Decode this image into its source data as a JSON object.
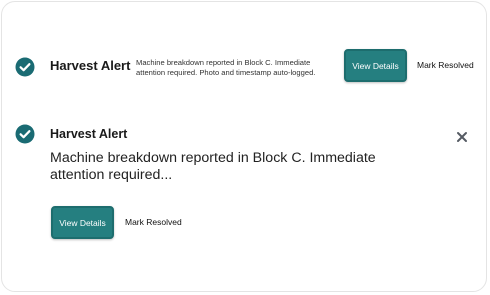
{
  "colors": {
    "accent": "#257f80",
    "check_fill": "#1a6b73",
    "close_icon": "#555b63"
  },
  "icons": {
    "status": "check-circle-icon",
    "dismiss": "close-icon"
  },
  "alert_compact": {
    "title": "Harvest Alert",
    "message": "Machine breakdown reported in Block C. Immediate attention required. Photo and timestamp auto-logged.",
    "view_label": "View Details",
    "resolve_label": "Mark Resolved"
  },
  "alert_expanded": {
    "title": "Harvest Alert",
    "message": "Machine breakdown reported in Block C. Immediate attention required...",
    "view_label": "View Details",
    "resolve_label": "Mark Resolved"
  }
}
